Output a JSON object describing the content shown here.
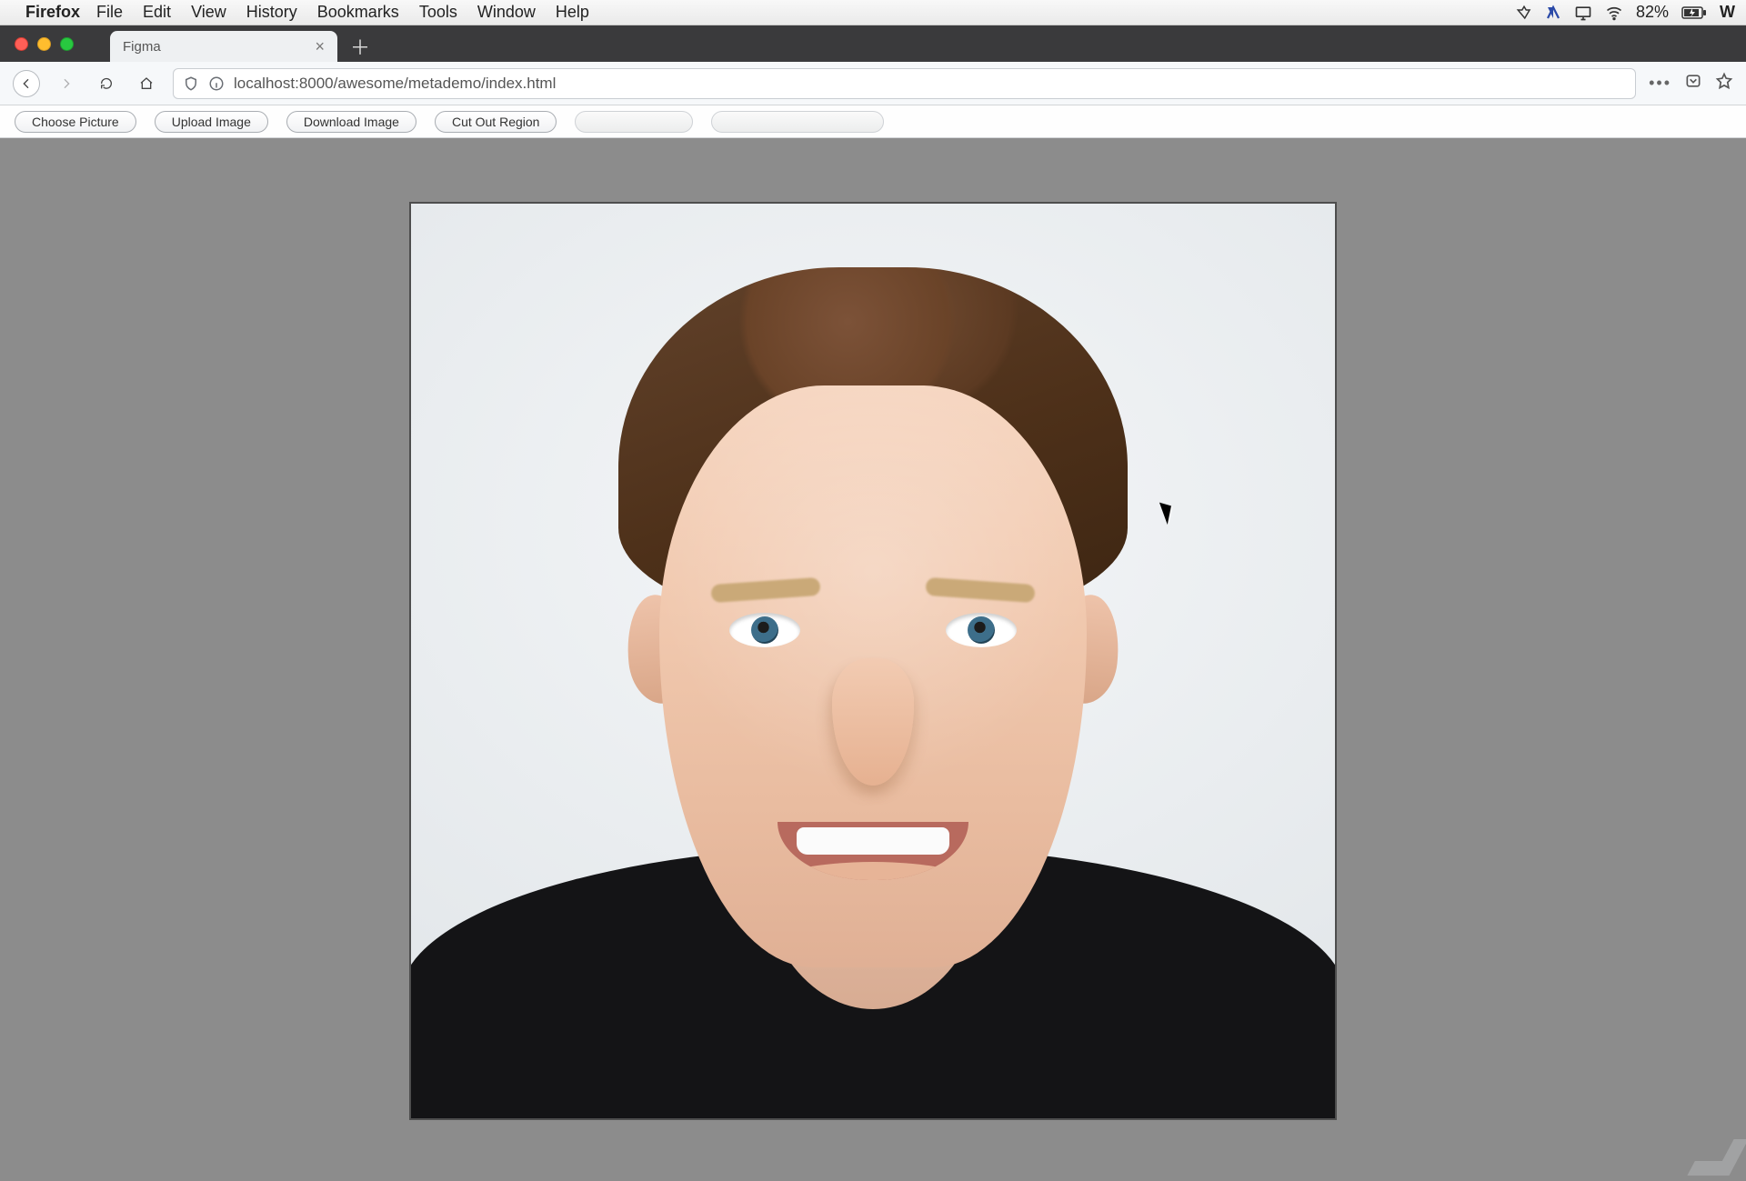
{
  "mac_menu": {
    "app_name": "Firefox",
    "items": [
      "File",
      "Edit",
      "View",
      "History",
      "Bookmarks",
      "Tools",
      "Window",
      "Help"
    ],
    "battery_percent": "82%",
    "right_letter": "W"
  },
  "browser": {
    "tab_title": "Figma",
    "url_display": "localhost:8000/awesome/metademo/index.html",
    "url_host_emphasis": "localhost"
  },
  "app_buttons": {
    "choose_picture": "Choose Picture",
    "upload_image": "Upload Image",
    "download_image": "Download Image",
    "cut_out_region": "Cut Out Region"
  }
}
